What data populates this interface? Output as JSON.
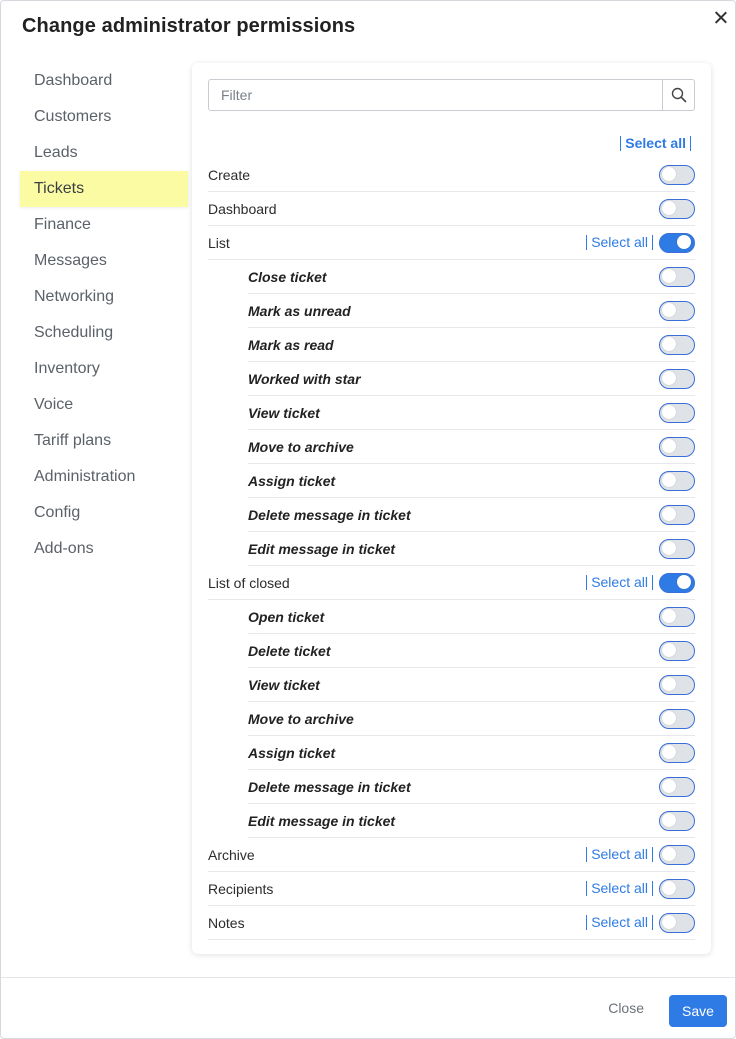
{
  "dialog": {
    "title": "Change administrator permissions",
    "close_icon": "close-icon"
  },
  "sidebar": {
    "items": [
      {
        "label": "Dashboard",
        "active": false
      },
      {
        "label": "Customers",
        "active": false
      },
      {
        "label": "Leads",
        "active": false
      },
      {
        "label": "Tickets",
        "active": true
      },
      {
        "label": "Finance",
        "active": false
      },
      {
        "label": "Messages",
        "active": false
      },
      {
        "label": "Networking",
        "active": false
      },
      {
        "label": "Scheduling",
        "active": false
      },
      {
        "label": "Inventory",
        "active": false
      },
      {
        "label": "Voice",
        "active": false
      },
      {
        "label": "Tariff plans",
        "active": false
      },
      {
        "label": "Administration",
        "active": false
      },
      {
        "label": "Config",
        "active": false
      },
      {
        "label": "Add-ons",
        "active": false
      }
    ]
  },
  "filter": {
    "placeholder": "Filter",
    "value": "",
    "icon": "search-icon"
  },
  "select_all_label": "Select all",
  "permissions": [
    {
      "label": "Create",
      "enabled": false,
      "select_all": false,
      "level": 0
    },
    {
      "label": "Dashboard",
      "enabled": false,
      "select_all": false,
      "level": 0
    },
    {
      "label": "List",
      "enabled": true,
      "select_all": true,
      "level": 0
    },
    {
      "label": "Close ticket",
      "enabled": false,
      "select_all": false,
      "level": 1
    },
    {
      "label": "Mark as unread",
      "enabled": false,
      "select_all": false,
      "level": 1
    },
    {
      "label": "Mark as read",
      "enabled": false,
      "select_all": false,
      "level": 1
    },
    {
      "label": "Worked with star",
      "enabled": false,
      "select_all": false,
      "level": 1
    },
    {
      "label": "View ticket",
      "enabled": false,
      "select_all": false,
      "level": 1
    },
    {
      "label": "Move to archive",
      "enabled": false,
      "select_all": false,
      "level": 1
    },
    {
      "label": "Assign ticket",
      "enabled": false,
      "select_all": false,
      "level": 1
    },
    {
      "label": "Delete message in ticket",
      "enabled": false,
      "select_all": false,
      "level": 1
    },
    {
      "label": "Edit message in ticket",
      "enabled": false,
      "select_all": false,
      "level": 1
    },
    {
      "label": "List of closed",
      "enabled": true,
      "select_all": true,
      "level": 0
    },
    {
      "label": "Open ticket",
      "enabled": false,
      "select_all": false,
      "level": 1
    },
    {
      "label": "Delete ticket",
      "enabled": false,
      "select_all": false,
      "level": 1
    },
    {
      "label": "View ticket",
      "enabled": false,
      "select_all": false,
      "level": 1
    },
    {
      "label": "Move to archive",
      "enabled": false,
      "select_all": false,
      "level": 1
    },
    {
      "label": "Assign ticket",
      "enabled": false,
      "select_all": false,
      "level": 1
    },
    {
      "label": "Delete message in ticket",
      "enabled": false,
      "select_all": false,
      "level": 1
    },
    {
      "label": "Edit message in ticket",
      "enabled": false,
      "select_all": false,
      "level": 1
    },
    {
      "label": "Archive",
      "enabled": false,
      "select_all": true,
      "level": 0
    },
    {
      "label": "Recipients",
      "enabled": false,
      "select_all": true,
      "level": 0
    },
    {
      "label": "Notes",
      "enabled": false,
      "select_all": true,
      "level": 0
    }
  ],
  "footer": {
    "close_label": "Close",
    "save_label": "Save"
  },
  "colors": {
    "accent": "#2f7be5",
    "active_nav": "#fbfba3"
  }
}
